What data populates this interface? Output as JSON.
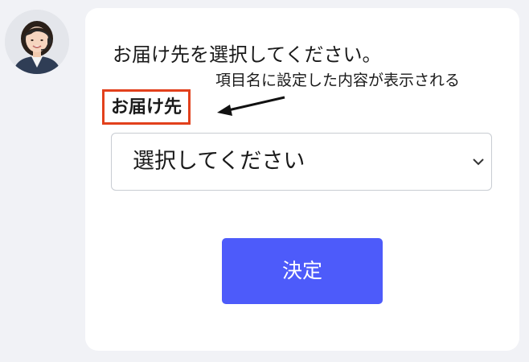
{
  "assistant": {
    "avatar_icon": "operator-avatar-icon"
  },
  "form": {
    "prompt": "お届け先を選択してください。",
    "annotation": "項目名に設定した内容が表示される",
    "field_label": "お届け先",
    "select": {
      "selected_value": "選択してください",
      "icon": "chevron-down-icon"
    },
    "submit_label": "決定"
  },
  "colors": {
    "page_background": "#f1f2f6",
    "card_background": "#ffffff",
    "highlight_border": "#e2401c",
    "button_background": "#4d5bfa",
    "button_text": "#ffffff"
  }
}
